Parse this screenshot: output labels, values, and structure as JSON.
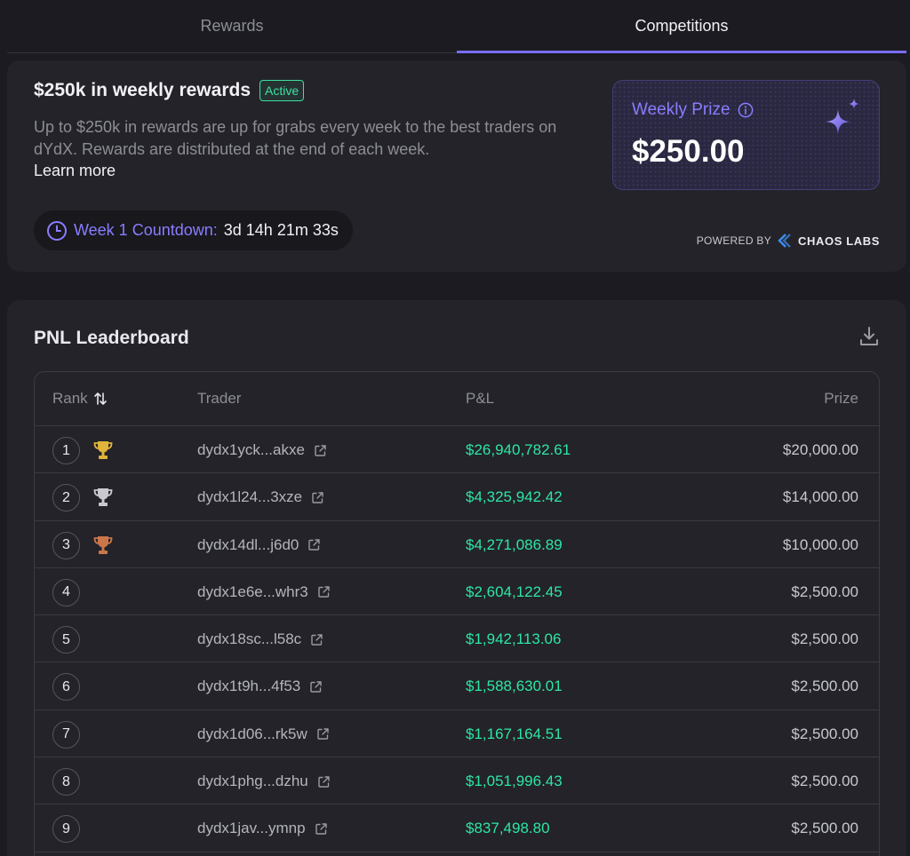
{
  "tabs": [
    {
      "label": "Rewards",
      "active": false
    },
    {
      "label": "Competitions",
      "active": true
    }
  ],
  "hero": {
    "title": "$250k in weekly rewards",
    "badge": "Active",
    "description": "Up to $250k in rewards are up for grabs every week to the best traders on dYdX. Rewards are distributed at the end of each week.",
    "learn_more": "Learn more",
    "countdown_label": "Week 1 Countdown:",
    "countdown_value": "3d 14h 21m 33s",
    "weekly_prize_label": "Weekly Prize",
    "weekly_prize_value": "$250.00",
    "powered_by": "POWERED BY",
    "powered_brand": "CHAOS LABS"
  },
  "leaderboard": {
    "title": "PNL Leaderboard",
    "columns": {
      "rank": "Rank",
      "trader": "Trader",
      "pnl": "P&L",
      "prize": "Prize"
    },
    "rows": [
      {
        "rank": "1",
        "trader": "dydx1yck...akxe",
        "pnl": "$26,940,782.61",
        "prize": "$20,000.00",
        "trophy": "gold"
      },
      {
        "rank": "2",
        "trader": "dydx1l24...3xze",
        "pnl": "$4,325,942.42",
        "prize": "$14,000.00",
        "trophy": "silver"
      },
      {
        "rank": "3",
        "trader": "dydx14dl...j6d0",
        "pnl": "$4,271,086.89",
        "prize": "$10,000.00",
        "trophy": "bronze"
      },
      {
        "rank": "4",
        "trader": "dydx1e6e...whr3",
        "pnl": "$2,604,122.45",
        "prize": "$2,500.00",
        "trophy": ""
      },
      {
        "rank": "5",
        "trader": "dydx18sc...l58c",
        "pnl": "$1,942,113.06",
        "prize": "$2,500.00",
        "trophy": ""
      },
      {
        "rank": "6",
        "trader": "dydx1t9h...4f53",
        "pnl": "$1,588,630.01",
        "prize": "$2,500.00",
        "trophy": ""
      },
      {
        "rank": "7",
        "trader": "dydx1d06...rk5w",
        "pnl": "$1,167,164.51",
        "prize": "$2,500.00",
        "trophy": ""
      },
      {
        "rank": "8",
        "trader": "dydx1phg...dzhu",
        "pnl": "$1,051,996.43",
        "prize": "$2,500.00",
        "trophy": ""
      },
      {
        "rank": "9",
        "trader": "dydx1jav...ymnp",
        "pnl": "$837,498.80",
        "prize": "$2,500.00",
        "trophy": ""
      }
    ]
  },
  "colors": {
    "accent": "#7a6cf2",
    "positive": "#2ee6a3",
    "gold": "#e0b43a",
    "silver": "#c9c9cf",
    "bronze": "#c9774a"
  }
}
